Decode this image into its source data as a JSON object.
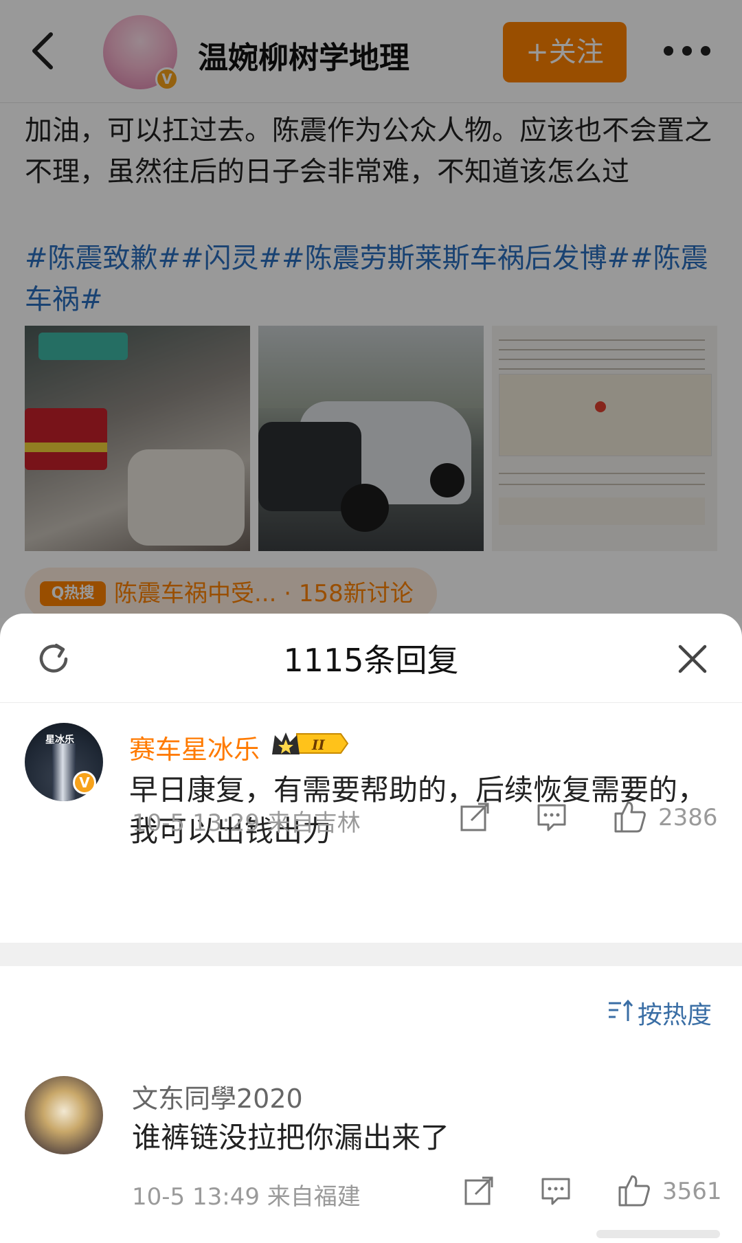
{
  "header": {
    "author_name": "温婉柳树学地理",
    "follow_label": "+关注",
    "verified_badge": "V"
  },
  "post": {
    "text": "加油，可以扛过去。陈震作为公众人物。应该也不会置之不理，虽然往后的日子会非常难，不知道该怎么过",
    "tags": "#陈震致歉##闪灵##陈震劳斯莱斯车祸后发博##陈震车祸#"
  },
  "hot_search": {
    "icon_label": "Q热搜",
    "text": "陈震车祸中受... · 158新讨论"
  },
  "sheet": {
    "title": "1115条回复"
  },
  "top_comment": {
    "avatar_text": "星冰乐",
    "user": "赛车星冰乐",
    "level_badge": "II",
    "text": "早日康复，有需要帮助的，后续恢复需要的，我可以出钱出力",
    "time_location": "10-5 13:29  来自吉林",
    "likes": "2386"
  },
  "sort": {
    "label": "按热度"
  },
  "reply_comment": {
    "user": "文东同學2020",
    "text": "谁裤链没拉把你漏出来了",
    "time_location": "10-5 13:49  来自福建",
    "likes": "3561"
  },
  "colors": {
    "brand_orange": "#ff8200",
    "link_blue": "#2b6fbf",
    "username_orange": "#ff7a00"
  }
}
